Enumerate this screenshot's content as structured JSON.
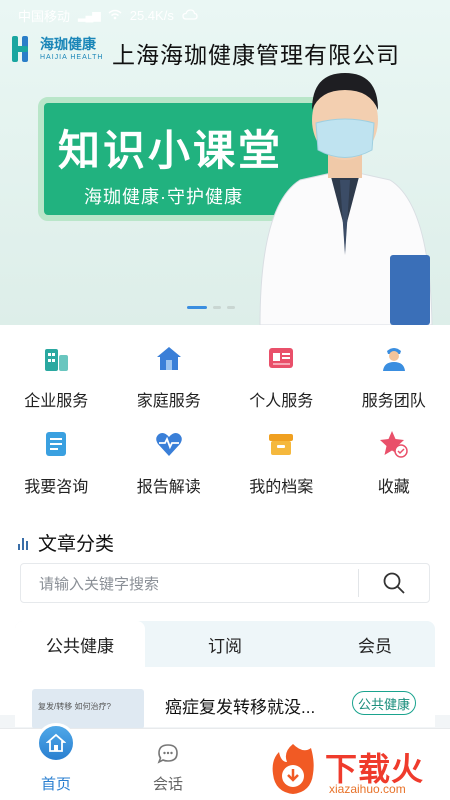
{
  "status_bar": {
    "carrier": "中国移动",
    "speed": "25.4K/s"
  },
  "banner": {
    "logo_cn": "海珈健康",
    "logo_en": "HAIJIA HEALTH",
    "company": "上海海珈健康管理有限公司",
    "card_title": "知识小课堂",
    "card_subtitle": "海珈健康·守护健康",
    "active_slide": 1,
    "slide_count": 3
  },
  "services": [
    {
      "label": "企业服务",
      "icon": "building-icon",
      "color": "#2aa8a0"
    },
    {
      "label": "家庭服务",
      "icon": "house-icon",
      "color": "#3a7fd8"
    },
    {
      "label": "个人服务",
      "icon": "id-card-icon",
      "color": "#e9506a"
    },
    {
      "label": "服务团队",
      "icon": "nurse-icon",
      "color": "#3a8ee0"
    },
    {
      "label": "我要咨询",
      "icon": "document-icon",
      "color": "#3aa0e0"
    },
    {
      "label": "报告解读",
      "icon": "heart-pulse-icon",
      "color": "#3a7fd8"
    },
    {
      "label": "我的档案",
      "icon": "archive-box-icon",
      "color": "#f0a020"
    },
    {
      "label": "收藏",
      "icon": "star-badge-icon",
      "color": "#e9506a"
    }
  ],
  "articles": {
    "title": "文章分类",
    "search_placeholder": "请输入关键字搜索",
    "tabs": [
      "公共健康",
      "订阅",
      "会员"
    ],
    "active_tab": 0,
    "items": [
      {
        "thumb_text": "复发/转移 如何治疗?",
        "title": "癌症复发转移就没...",
        "badge": "公共健康"
      }
    ]
  },
  "bottom_nav": {
    "items": [
      {
        "label": "首页",
        "icon": "home-icon",
        "active": true
      },
      {
        "label": "会话",
        "icon": "chat-icon",
        "active": false
      }
    ]
  },
  "watermark": {
    "brand": "下载火",
    "url": "xiazaihuo.com"
  }
}
